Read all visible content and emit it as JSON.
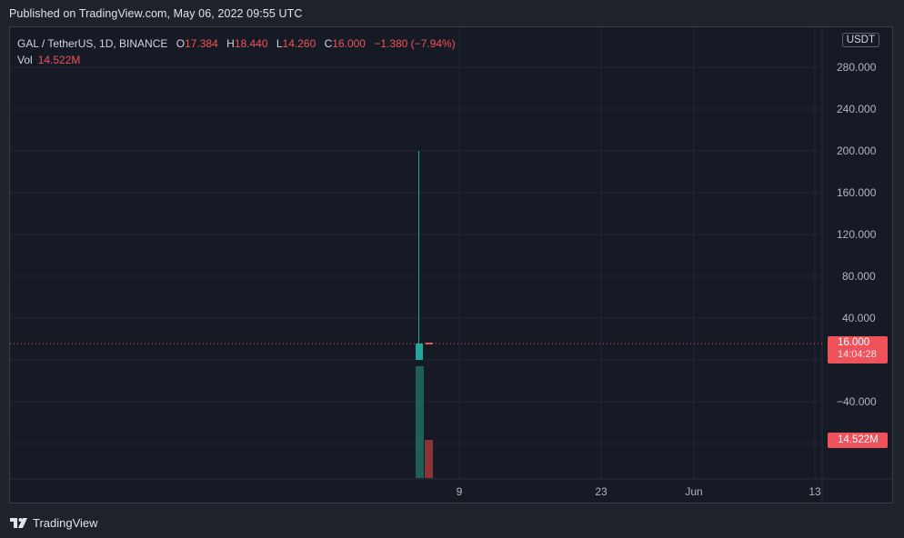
{
  "header": {
    "published": "Published on TradingView.com, May 06, 2022 09:55 UTC"
  },
  "legend": {
    "symbol": "GAL / TetherUS, 1D, BINANCE",
    "open_label": "O",
    "open": "17.384",
    "high_label": "H",
    "high": "18.440",
    "low_label": "L",
    "low": "14.260",
    "close_label": "C",
    "close": "16.000",
    "change": "−1.380 (−7.94%)",
    "vol_label": "Vol",
    "vol": "14.522M"
  },
  "currency_button": "USDT",
  "price_label": {
    "value": "16.000",
    "countdown": "14:04:28"
  },
  "volume_label": "14.522M",
  "footer": {
    "brand": "TradingView"
  },
  "colors": {
    "up": "#26a69a",
    "down": "#f0525b",
    "volume_up": "#1f5f5a",
    "volume_down": "#8a3436",
    "background": "#161a25",
    "grid": "#232733"
  },
  "chart_data": {
    "type": "candlestick",
    "y_ticks": [
      "280.000",
      "240.000",
      "200.000",
      "160.000",
      "120.000",
      "80.000",
      "40.000",
      "",
      "−40.000"
    ],
    "x_ticks": [
      "9",
      "23",
      "Jun",
      "13"
    ],
    "candles": [
      {
        "open": 1,
        "high": 200,
        "low": 0,
        "close": 17.384,
        "direction": "up"
      },
      {
        "open": 17.384,
        "high": 18.44,
        "low": 14.26,
        "close": 16.0,
        "direction": "down"
      }
    ],
    "volume": [
      {
        "value": "large",
        "direction": "up"
      },
      {
        "value": "14.522M",
        "direction": "down"
      }
    ],
    "last_price": 16.0
  }
}
